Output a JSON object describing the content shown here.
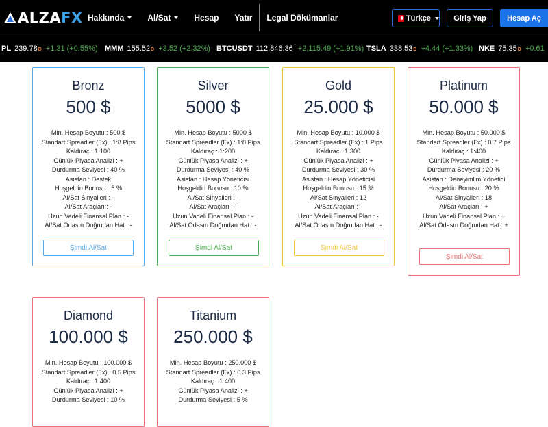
{
  "nav": {
    "logo_main": "ALZA",
    "logo_accent": "FX",
    "menu": [
      {
        "label": "Hakkında",
        "has_caret": true
      },
      {
        "label": "Al/Sat",
        "has_caret": true
      },
      {
        "label": "Hesap",
        "has_caret": false
      },
      {
        "label": "Yatır",
        "has_caret": false
      },
      {
        "label": "Legal Dökümanlar",
        "has_caret": false
      }
    ],
    "language": "Türkçe",
    "login_label": "Giriş Yap",
    "open_account_label": "Hesap Aç"
  },
  "ticker": [
    {
      "symbol": "PL",
      "price": "239.78",
      "marker": "D",
      "change": "+1.31 (+0.55%)"
    },
    {
      "symbol": "MMM",
      "price": "155.52",
      "marker": "D",
      "change": "+3.52 (+2.32%)"
    },
    {
      "symbol": "BTCUSDT",
      "price": "112,846.36",
      "marker": "",
      "change": "+2,115.49 (+1.91%)"
    },
    {
      "symbol": "TSLA",
      "price": "338.53",
      "marker": "D",
      "change": "+4.44 (+1.33%)"
    },
    {
      "symbol": "NKE",
      "price": "75.35",
      "marker": "D",
      "change": "+0.61"
    }
  ],
  "colors": {
    "bronz": "#5aa9e6",
    "silver": "#4caf50",
    "gold": "#f5c542",
    "platinum": "#e57373",
    "diamond": "#e57373",
    "titanium": "#e57373",
    "nav_accent": "#1a73e8"
  },
  "cards": {
    "bronz": {
      "name": "Bronz",
      "price": "500 $",
      "features": [
        "Min. Hesap Boyutu : 500 $",
        "Standart Spreadler (Fx) : 1:8 Pips",
        "Kaldıraç : 1:100",
        "Günlük Piyasa Analizi : +",
        "Durdurma Seviyesi : 40 %",
        "Asistan : Destek",
        "Hoşgeldin Bonusu : 5 %",
        "Al/Sat Sinyalleri : -",
        "Al/Sat Araçları : -",
        "Uzun Vadeli Finansal Plan : -",
        "Al/Sat Odasın Doğrudan Hat : -"
      ],
      "button": "Şimdi Al/Sat"
    },
    "silver": {
      "name": "Silver",
      "price": "5000 $",
      "features": [
        "Min. Hesap Boyutu : 5000 $",
        "Standart Spreadler (Fx) : 1:8 Pips",
        "Kaldıraç : 1:200",
        "Günlük Piyasa Analizi : +",
        "Durdurma Seviyesi : 40 %",
        "Asistan : Hesap Yöneticisi",
        "Hoşgeldin Bonusu : 10 %",
        "Al/Sat Sinyalleri : -",
        "Al/Sat Araçları : -",
        "Uzun Vadeli Finansal Plan : -",
        "Al/Sat Odasın Doğrudan Hat : -"
      ],
      "button": "Şimdi Al/Sat"
    },
    "gold": {
      "name": "Gold",
      "price": "25.000 $",
      "features": [
        "Min. Hesap Boyutu : 10.000 $",
        "Standart Spreadler (Fx) : 1 Pips",
        "Kaldıraç : 1:300",
        "Günlük Piyasa Analizi : +",
        "Durdurma Seviyesi : 30 %",
        "Asistan : Hesap Yöneticisi",
        "Hoşgeldin Bonusu : 15 %",
        "Al/Sat Sinyalleri : 12",
        "Al/Sat Araçları : -",
        "Uzun Vadeli Finansal Plan : -",
        "Al/Sat Odasın Doğrudan Hat : -"
      ],
      "button": "Şimdi Al/Sat"
    },
    "platinum": {
      "name": "Platinum",
      "price": "50.000 $",
      "features": [
        "Min. Hesap Boyutu : 50.000 $",
        "Standart Spreadler (Fx) : 0.7 Pips",
        "Kaldıraç : 1:400",
        "Günlük Piyasa Analizi : +",
        "Durdurma Seviyesi : 20 %",
        "Asistan : Deneyimlim Yönetici",
        "Hoşgeldin Bonusu : 20 %",
        "Al/Sat Sinyalleri : 18",
        "Al/Sat Araçları : +",
        "Uzun Vadeli Finansal Plan : +",
        "Al/Sat Odasın Doğrudan Hat : +"
      ],
      "button": "Şimdi Al/Sat"
    },
    "diamond": {
      "name": "Diamond",
      "price": "100.000 $",
      "features": [
        "Min. Hesap Boyutu : 100.000 $",
        "Standart Spreadler (Fx) : 0.5 Pips",
        "Kaldıraç : 1:400",
        "Günlük Piyasa Analizi : +",
        "Durdurma Seviyesi : 10 %"
      ]
    },
    "titanium": {
      "name": "Titanium",
      "price": "250.000 $",
      "features": [
        "Min. Hesap Boyutu : 250.000 $",
        "Standart Spreadler (Fx) : 0.3 Pips",
        "Kaldıraç : 1:400",
        "Günlük Piyasa Analizi : +",
        "Durdurma Seviyesi : 5 %"
      ]
    }
  }
}
